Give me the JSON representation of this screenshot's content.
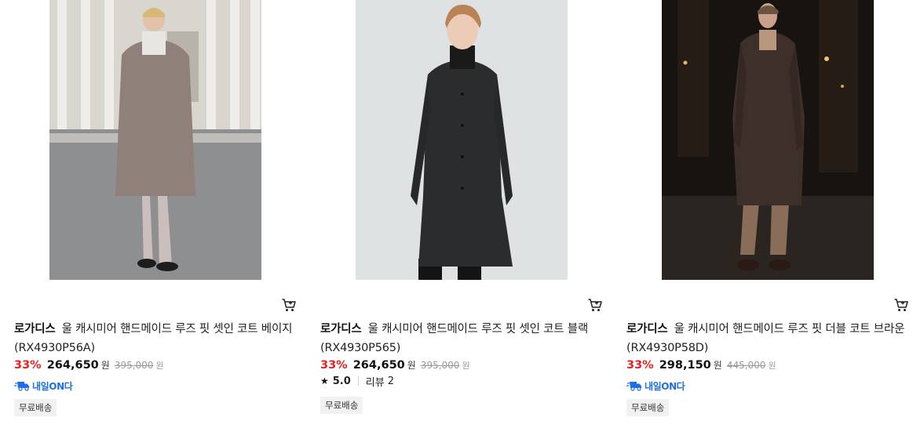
{
  "products": [
    {
      "brand": "로가디스",
      "name": "울 캐시미어 핸드메이드 루즈 핏 셋인 코트 베이지 (RX4930P56A)",
      "discount": "33%",
      "price": "264,650",
      "currency": "원",
      "original_price": "395,000",
      "original_currency": "원",
      "delivery_badge": "내일ON다",
      "tag": "무료배송",
      "image": "model in beige wool coat on city street",
      "cart_icon": "cart-icon"
    },
    {
      "brand": "로가디스",
      "name": "울 캐시미어 핸드메이드 루즈 핏 셋인 코트 블랙 (RX4930P565)",
      "discount": "33%",
      "price": "264,650",
      "currency": "원",
      "original_price": "395,000",
      "original_currency": "원",
      "rating": "5.0",
      "review_label": "리뷰",
      "review_count": "2",
      "tag": "무료배송",
      "image": "model in black coat on light grey background",
      "cart_icon": "cart-icon"
    },
    {
      "brand": "로가디스",
      "name": "울 캐시미어 핸드메이드 루즈 핏 더블 코트 브라운 (RX4930P58D)",
      "discount": "33%",
      "price": "298,150",
      "currency": "원",
      "original_price": "445,000",
      "original_currency": "원",
      "delivery_badge": "내일ON다",
      "tag": "무료배송",
      "image": "model in brown double coat at night",
      "cart_icon": "cart-icon"
    }
  ],
  "colors": {
    "discount": "#e62222",
    "delivery_badge": "#1d6fe8",
    "tag_bg": "#f1f1f1"
  }
}
